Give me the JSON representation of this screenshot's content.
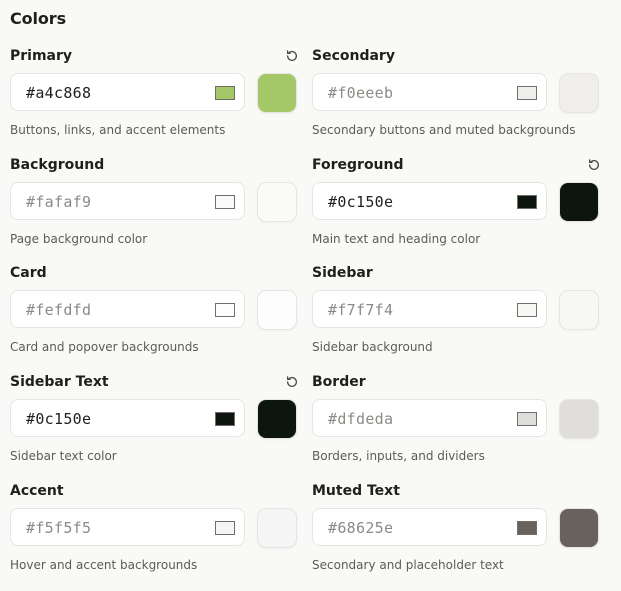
{
  "section_title": "Colors",
  "colors": [
    {
      "label": "Primary",
      "value": "#a4c868",
      "description": "Buttons, links, and accent elements",
      "color": "#a4c868",
      "modified": true,
      "reset_icon": "reset-icon"
    },
    {
      "label": "Secondary",
      "value": "#f0eeeb",
      "description": "Secondary buttons and muted backgrounds",
      "color": "#f0eeeb",
      "modified": false
    },
    {
      "label": "Background",
      "value": "#fafaf9",
      "description": "Page background color",
      "color": "#fafaf9",
      "modified": false
    },
    {
      "label": "Foreground",
      "value": "#0c150e",
      "description": "Main text and heading color",
      "color": "#0c150e",
      "modified": true,
      "reset_icon": "reset-icon"
    },
    {
      "label": "Card",
      "value": "#fefdfd",
      "description": "Card and popover backgrounds",
      "color": "#fefdfd",
      "modified": false
    },
    {
      "label": "Sidebar",
      "value": "#f7f7f4",
      "description": "Sidebar background",
      "color": "#f7f7f4",
      "modified": false
    },
    {
      "label": "Sidebar Text",
      "value": "#0c150e",
      "description": "Sidebar text color",
      "color": "#0c150e",
      "modified": true,
      "reset_icon": "reset-icon"
    },
    {
      "label": "Border",
      "value": "#dfdeda",
      "description": "Borders, inputs, and dividers",
      "color": "#dfdeda",
      "modified": false
    },
    {
      "label": "Accent",
      "value": "#f5f5f5",
      "description": "Hover and accent backgrounds",
      "color": "#f5f5f5",
      "modified": false
    },
    {
      "label": "Muted Text",
      "value": "#68625e",
      "description": "Secondary and placeholder text",
      "color": "#68625e",
      "modified": false
    }
  ]
}
